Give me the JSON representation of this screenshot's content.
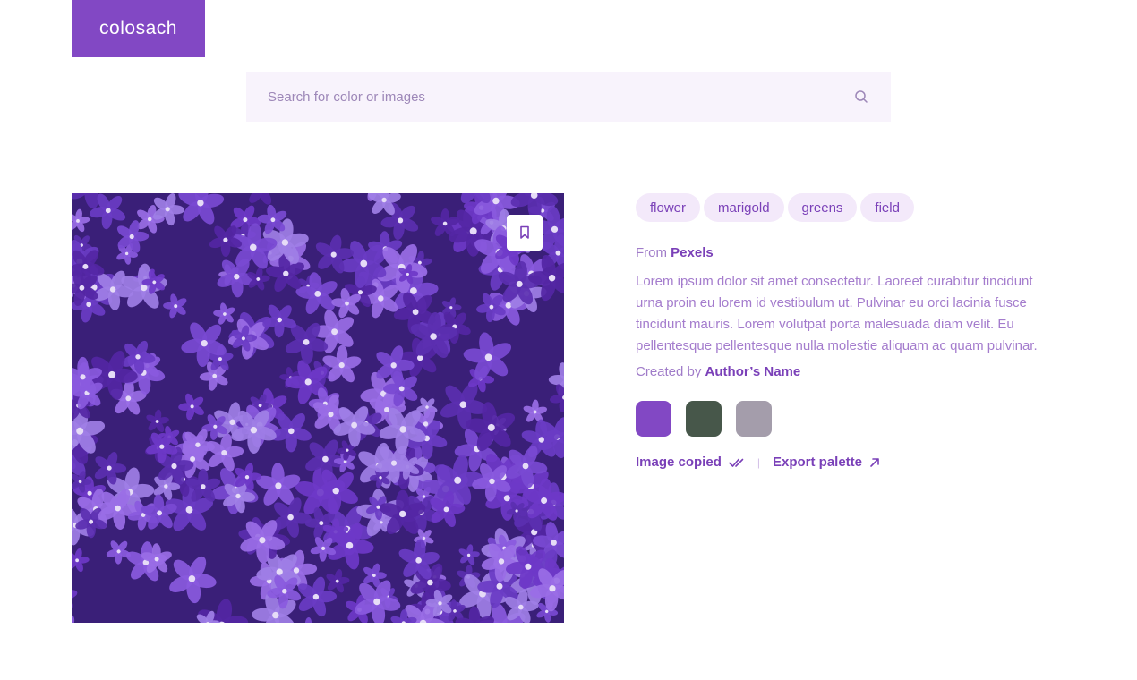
{
  "logo": {
    "text": "colosach"
  },
  "search": {
    "placeholder": "Search for color or images"
  },
  "tags": [
    "flower",
    "marigold",
    "greens",
    "field"
  ],
  "source": {
    "prefix": "From",
    "name": "Pexels"
  },
  "description": "Lorem ipsum dolor sit amet consectetur. Laoreet curabitur tincidunt urna proin eu lorem id vestibulum ut. Pulvinar eu orci lacinia fusce tincidunt mauris. Lorem volutpat porta malesuada diam velit. Eu pellentesque pellentesque nulla molestie aliquam ac quam pulvinar.",
  "author": {
    "prefix": "Created by",
    "name": "Author’s Name"
  },
  "palette": [
    "#8248c4",
    "#47574a",
    "#a49dab"
  ],
  "actions": {
    "copied_label": "Image copied",
    "export_label": "Export palette"
  },
  "colors": {
    "brand": "#8248c4",
    "search_bg": "#f8f3fc",
    "tag_bg": "#f3e9fa"
  }
}
